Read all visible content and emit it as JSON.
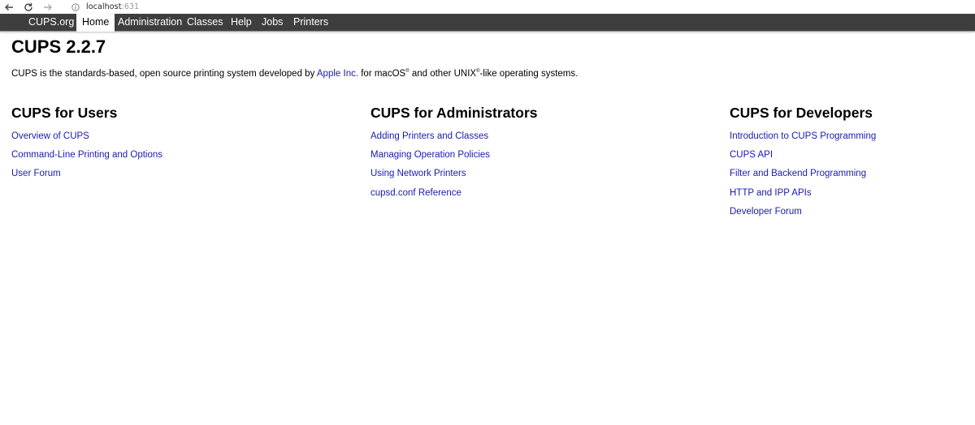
{
  "browser": {
    "url_host": "localhost",
    "url_port": ":631",
    "back_icon": "arrow-left-icon",
    "reload_icon": "reload-icon",
    "forward_icon": "arrow-right-icon",
    "info_icon": "info-icon"
  },
  "nav": {
    "items": [
      {
        "label": "CUPS.org",
        "active": false
      },
      {
        "label": "Home",
        "active": true
      },
      {
        "label": "Administration",
        "active": false
      },
      {
        "label": "Classes",
        "active": false
      },
      {
        "label": "Help",
        "active": false
      },
      {
        "label": "Jobs",
        "active": false
      },
      {
        "label": "Printers",
        "active": false
      }
    ],
    "bg_color": "#3e3e3e"
  },
  "page": {
    "title": "CUPS 2.2.7",
    "intro_part1": "CUPS is the standards-based, open source printing system developed by ",
    "intro_link": "Apple Inc.",
    "intro_part2": " for macOS",
    "intro_sup1": "®",
    "intro_part3": " and other UNIX",
    "intro_sup2": "®",
    "intro_part4": "-like operating systems.",
    "link_color": "#1a1ab0"
  },
  "columns": [
    {
      "heading": "CUPS for Users",
      "links": [
        "Overview of CUPS",
        "Command-Line Printing and Options",
        "User Forum"
      ]
    },
    {
      "heading": "CUPS for Administrators",
      "links": [
        "Adding Printers and Classes",
        "Managing Operation Policies",
        "Using Network Printers",
        "cupsd.conf Reference"
      ]
    },
    {
      "heading": "CUPS for Developers",
      "links": [
        "Introduction to CUPS Programming",
        "CUPS API",
        "Filter and Backend Programming",
        "HTTP and IPP APIs",
        "Developer Forum"
      ]
    }
  ]
}
